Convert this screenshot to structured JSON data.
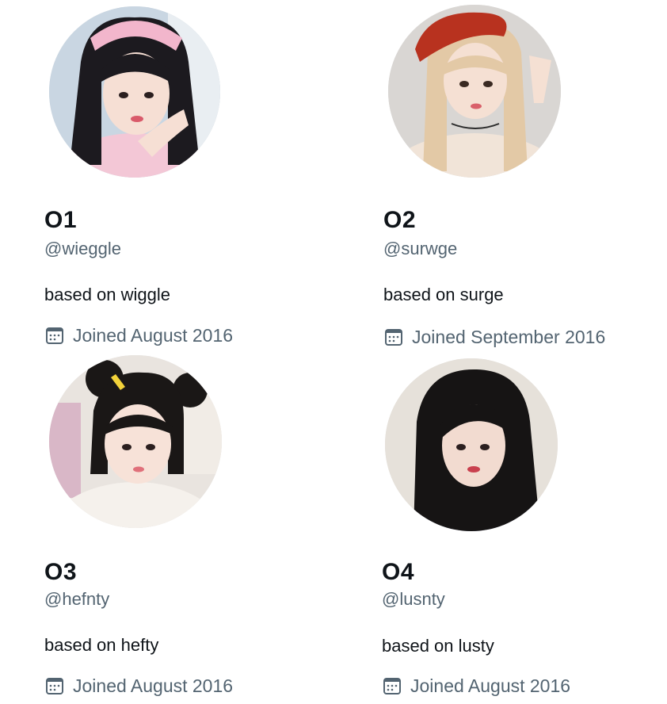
{
  "profiles": [
    {
      "name": "O1",
      "handle": "@wieggle",
      "bio": "based on wiggle",
      "joined": "Joined August 2016",
      "icon": "calendar-icon",
      "avatar_colors": {
        "bg": "#c9d6e2",
        "hair": "#1c1a1f",
        "accent": "#f2b6cc",
        "skin": "#f6dfd4"
      }
    },
    {
      "name": "O2",
      "handle": "@surwge",
      "bio": "based on surge",
      "joined": "Joined September 2016",
      "icon": "calendar-icon",
      "avatar_colors": {
        "bg": "#d9d6d3",
        "hair": "#e3c9a6",
        "accent": "#b8321f",
        "skin": "#f5e0d3"
      }
    },
    {
      "name": "O3",
      "handle": "@hefnty",
      "bio": "based on hefty",
      "joined": "Joined August 2016",
      "icon": "calendar-icon",
      "avatar_colors": {
        "bg": "#e9e4df",
        "hair": "#1a1716",
        "accent": "#f5f1ec",
        "skin": "#f7e2d8"
      }
    },
    {
      "name": "O4",
      "handle": "@lusnty",
      "bio": "based on lusty",
      "joined": "Joined August 2016",
      "icon": "calendar-icon",
      "avatar_colors": {
        "bg": "#e6e1da",
        "hair": "#161414",
        "accent": "#b9c4e6",
        "skin": "#f2dbd0"
      }
    }
  ],
  "colors": {
    "text_primary": "#0f1419",
    "text_secondary": "#536471",
    "background": "#ffffff"
  }
}
